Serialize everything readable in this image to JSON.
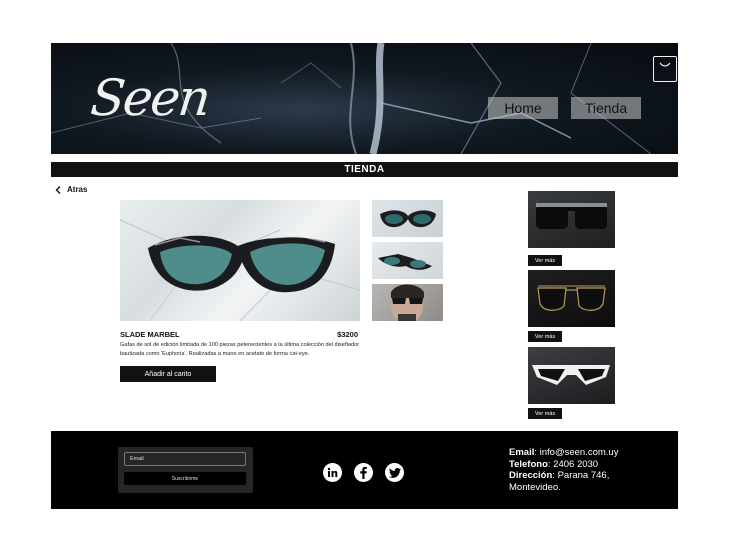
{
  "header": {
    "logo_text": "Seen",
    "nav": {
      "home": "Home",
      "tienda": "Tienda"
    },
    "cart_icon": "shopping-bag-icon"
  },
  "section": {
    "title": "TIENDA"
  },
  "back": {
    "label": "Atras"
  },
  "product": {
    "name": "SLADE MARBEL",
    "price": "$3200",
    "description": "Gafas de sol de edición limitada de 100 piezas petenecientes a la última colección del diseñador bautizada como 'Euphoria'. Realizadas a mano en acetato de forma cat-eye.",
    "add_to_cart": "Añadir al carito"
  },
  "related": [
    {
      "button": "Ver más"
    },
    {
      "button": "Ver más"
    },
    {
      "button": "Ver más"
    }
  ],
  "footer": {
    "email_placeholder": "Email",
    "subscribe": "Suscribirme",
    "social": [
      "linkedin-icon",
      "facebook-icon",
      "twitter-icon"
    ],
    "contact": {
      "email_label": "Email",
      "email_value": "info@seen.com.uy",
      "phone_label": "Telefono",
      "phone_value": "2406 2030",
      "address_label": "Dirección",
      "address_value": "Parana 746, Montevideo."
    }
  },
  "colors": {
    "dark": "#111111",
    "footer_bg": "#000000",
    "nav_button": "#c8c8c8"
  }
}
